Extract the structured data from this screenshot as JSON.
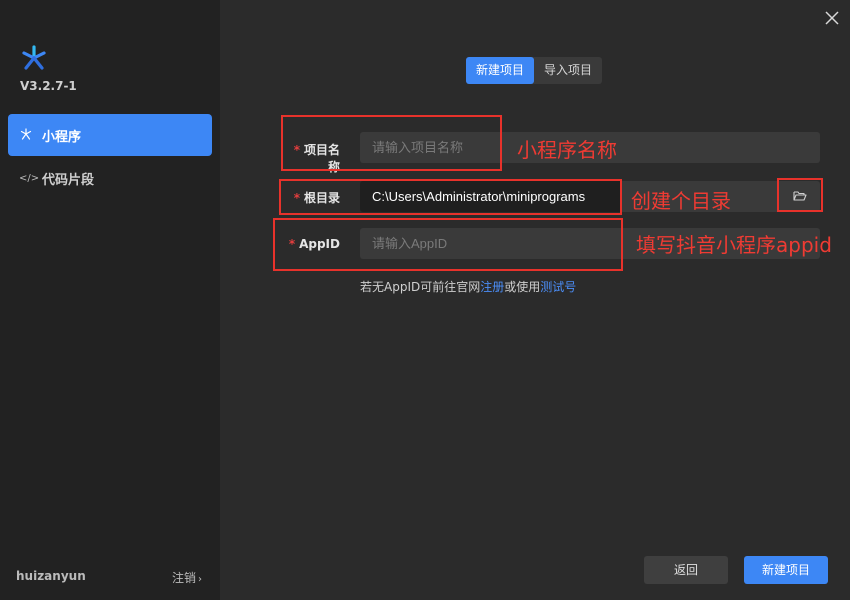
{
  "app": {
    "version": "V3.2.7-1"
  },
  "sidebar": {
    "items": [
      {
        "label": "小程序",
        "icon": "asterisk-icon",
        "active": true
      },
      {
        "label": "代码片段",
        "icon": "code-icon",
        "active": false
      }
    ],
    "username": "huizanyun",
    "logout_label": "注销"
  },
  "tabs": [
    {
      "label": "新建项目",
      "active": true
    },
    {
      "label": "导入项目",
      "active": false
    }
  ],
  "form": {
    "project_name": {
      "label": "项目名称",
      "required": true,
      "placeholder": "请输入项目名称",
      "value": ""
    },
    "root_dir": {
      "label": "根目录",
      "required": true,
      "value": "C:\\Users\\Administrator\\miniprograms"
    },
    "appid": {
      "label": "AppID",
      "required": true,
      "placeholder": "请输入AppID",
      "value": ""
    },
    "hint": {
      "prefix": "若无AppID可前往官网",
      "register_link": "注册",
      "middle": "或使用",
      "test_link": "测试号"
    }
  },
  "annotations": {
    "project_name_note": "小程序名称",
    "root_dir_note": "创建个目录",
    "appid_note": "填写抖音小程序appid"
  },
  "buttons": {
    "back": "返回",
    "create": "新建项目"
  },
  "colors": {
    "accent": "#3d87f5",
    "annotation": "#e8322b",
    "required": "#e53e3e",
    "link": "#4b8ef7"
  }
}
